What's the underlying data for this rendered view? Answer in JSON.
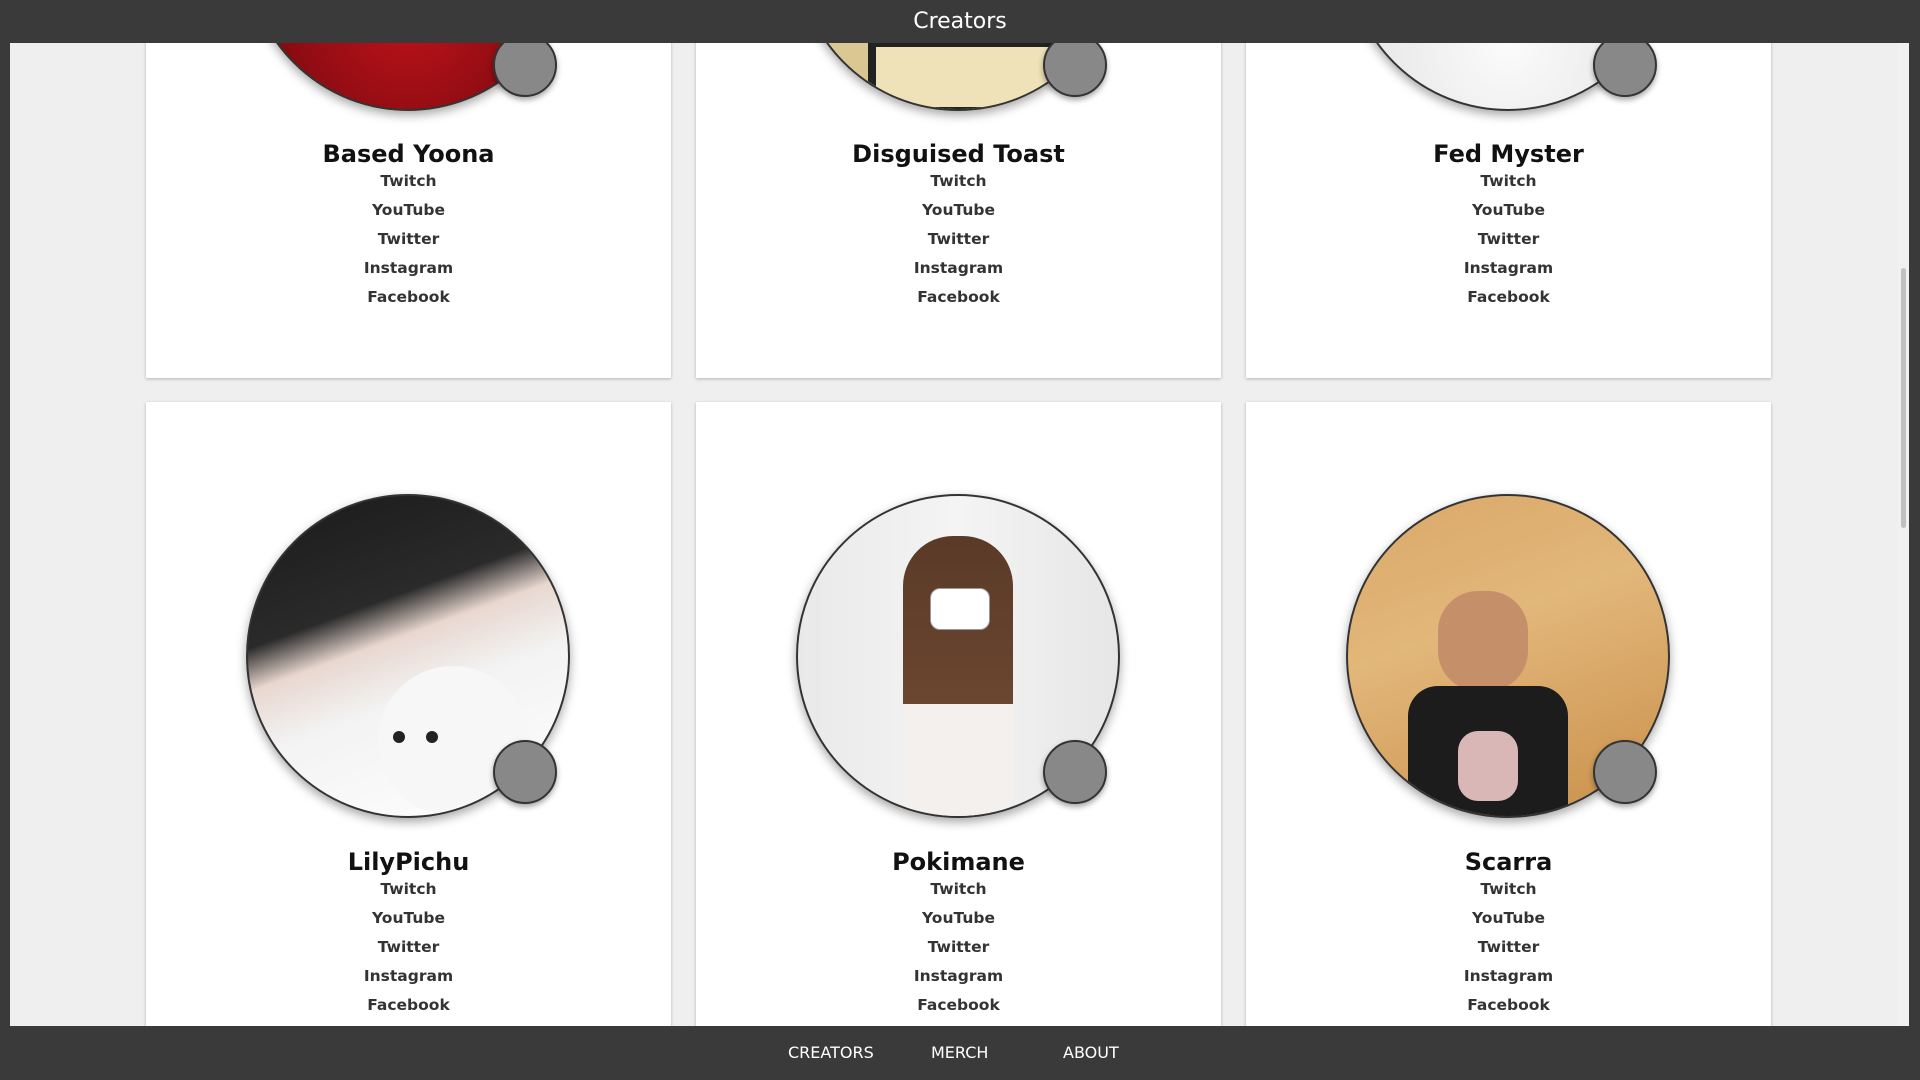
{
  "header": {
    "title": "Creators"
  },
  "creators": [
    {
      "name": "Based Yoona",
      "links": [
        "Twitch",
        "YouTube",
        "Twitter",
        "Instagram",
        "Facebook"
      ]
    },
    {
      "name": "Disguised Toast",
      "links": [
        "Twitch",
        "YouTube",
        "Twitter",
        "Instagram",
        "Facebook"
      ]
    },
    {
      "name": "Fed Myster",
      "links": [
        "Twitch",
        "YouTube",
        "Twitter",
        "Instagram",
        "Facebook"
      ]
    },
    {
      "name": "LilyPichu",
      "links": [
        "Twitch",
        "YouTube",
        "Twitter",
        "Instagram",
        "Facebook"
      ]
    },
    {
      "name": "Pokimane",
      "links": [
        "Twitch",
        "YouTube",
        "Twitter",
        "Instagram",
        "Facebook"
      ]
    },
    {
      "name": "Scarra",
      "links": [
        "Twitch",
        "YouTube",
        "Twitter",
        "Instagram",
        "Facebook"
      ]
    }
  ],
  "nav": {
    "items": [
      "CREATORS",
      "MERCH",
      "ABOUT"
    ]
  },
  "colors": {
    "bar": "#3a3a3a",
    "page_bg": "#efefef",
    "card_bg": "#ffffff",
    "status_dot": "#888888"
  }
}
